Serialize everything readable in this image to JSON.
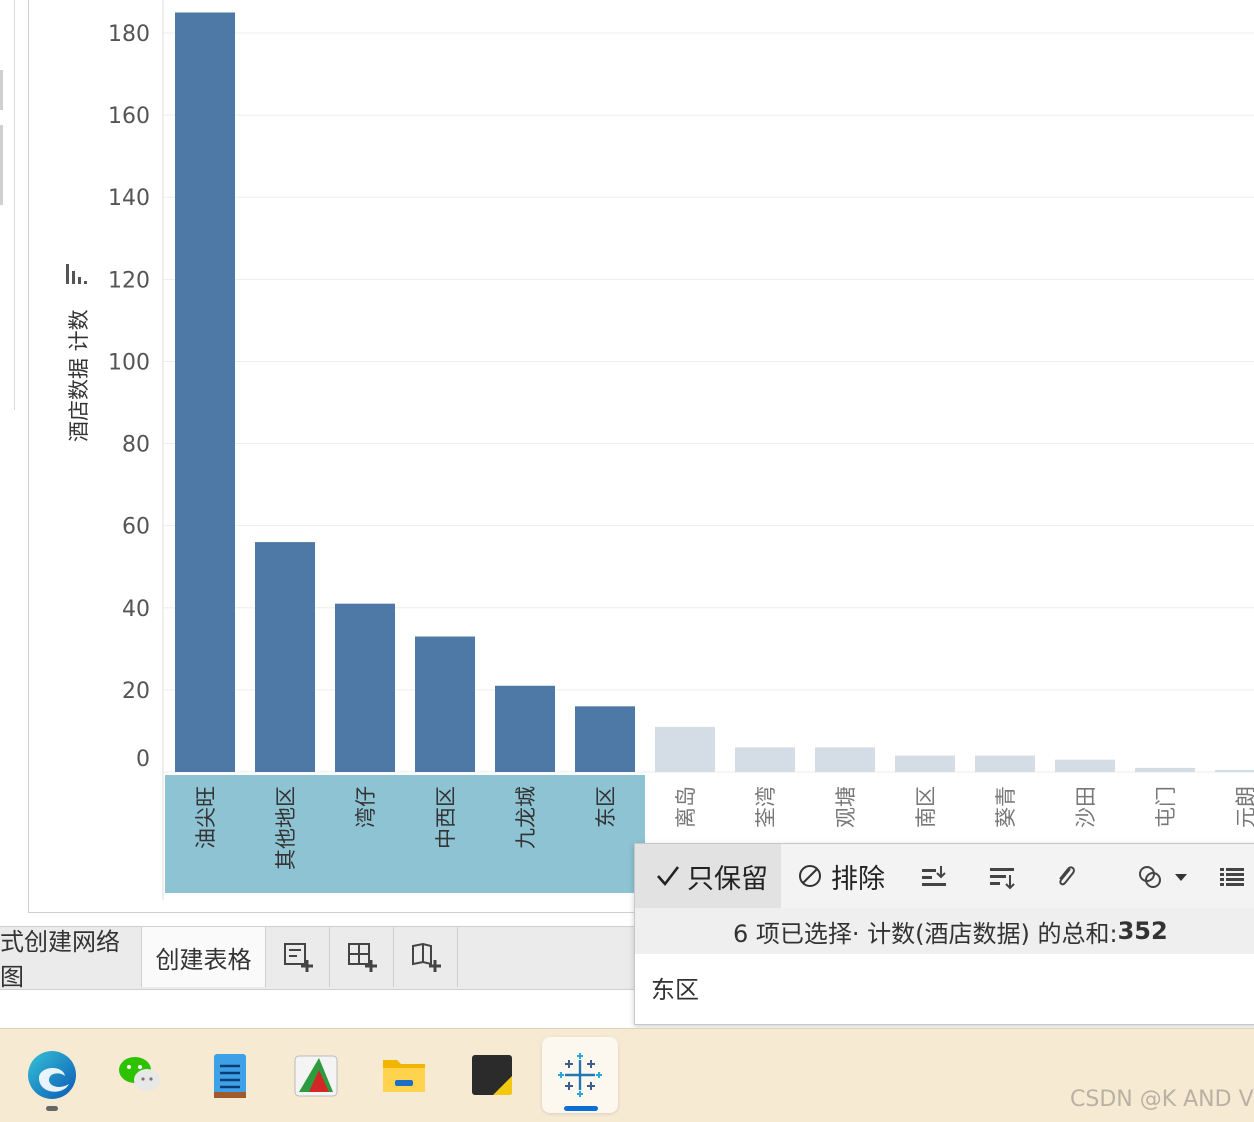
{
  "chart_data": {
    "type": "bar",
    "ylabel": "酒店数据 计数",
    "ylim": [
      0,
      180
    ],
    "yticks": [
      0,
      20,
      40,
      60,
      80,
      100,
      120,
      140,
      160,
      180
    ],
    "categories": [
      "油尖旺",
      "其他地区",
      "湾仔",
      "中西区",
      "九龙城",
      "东区",
      "离岛",
      "荃湾",
      "观塘",
      "南区",
      "葵青",
      "沙田",
      "屯门",
      "元朗"
    ],
    "values": [
      185,
      56,
      41,
      33,
      21,
      16,
      11,
      6,
      6,
      4,
      4,
      3,
      1,
      0.5
    ],
    "selected": [
      true,
      true,
      true,
      true,
      true,
      true,
      false,
      false,
      false,
      false,
      false,
      false,
      false,
      false
    ],
    "colors": {
      "selected_bar": "#4e79a7",
      "unselected_bar": "#d4dde5",
      "label_highlight": "#8dc3d3",
      "gridline": "#ededed"
    }
  },
  "tabs": {
    "tab1_label": "式创建网络图",
    "tab2_label": "创建表格",
    "icons": [
      "new-worksheet-icon",
      "new-dashboard-icon",
      "new-story-icon"
    ]
  },
  "popup": {
    "keep_label": "只保留",
    "exclude_label": "排除",
    "summary_prefix": "6 项已选择· 计数(酒店数据) 的总和: ",
    "summary_value": "352",
    "detail_value": "东区",
    "icons": [
      "sort-ascending-icon",
      "sort-descending-icon",
      "paperclip-icon",
      "group-icon",
      "view-data-icon"
    ]
  },
  "taskbar": {
    "apps": [
      "edge-icon",
      "wechat-icon",
      "notepad-icon",
      "greenshot-icon",
      "file-explorer-icon",
      "sticky-notes-icon",
      "tableau-icon"
    ],
    "watermark": "CSDN @K AND V"
  }
}
